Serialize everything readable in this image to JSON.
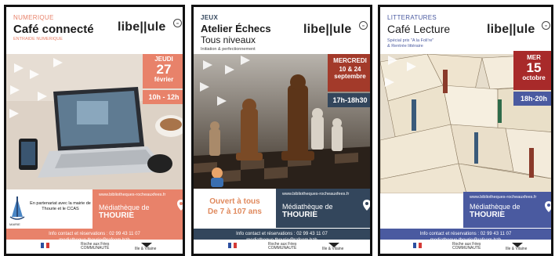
{
  "posters": [
    {
      "category": "NUMERIQUE",
      "title": "Café connecté",
      "subtitle_lines": [
        "ENTRAIDE NUMERIQUE"
      ],
      "logo": "libe||ule",
      "date": {
        "day_name": "JEUDI",
        "day": "27",
        "month": "février"
      },
      "time": "10h - 12h",
      "partner_text": "En partenariat avec la mairie de Thourie et le CCAS",
      "partner_logo_label": "MAIRIE",
      "url": "www.bibliotheques-rocheauxfees.fr",
      "venue_line1": "Médiathèque de",
      "venue_line2": "THOURIE",
      "contact_line1": "Info contact et réservations : 02 99 43 11 07",
      "contact_line2": "mediatheque.thourie@rafcom.bzh",
      "footer": {
        "cc_line1": "Roche aux Fées",
        "cc_line2": "COMMUNAUTÉ",
        "dept": "Ille & Vilaine"
      },
      "colors": {
        "accent": "#e8826a",
        "contact_bg": "#e8826a"
      }
    },
    {
      "category": "JEUX",
      "title": "Atelier Échecs",
      "title2": "Tous niveaux",
      "subtitle_lines": [
        "Initiation & perfectionnement"
      ],
      "logo": "libe||ule",
      "date": {
        "day_name": "MERCREDI",
        "day": "10 & 24",
        "month": "septembre"
      },
      "time": "17h-18h30",
      "open_line1": "Ouvert à tous",
      "open_line2": "De 7 à 107 ans",
      "url": "www.bibliotheques-rocheauxfees.fr",
      "venue_line1": "Médiathèque de",
      "venue_line2": "THOURIE",
      "contact_line1": "Info contact et réservations : 02 99 43 11 07",
      "contact_line2": "mediatheque.thourie@rafcom.bzh",
      "footer": {
        "cc_line1": "Roche aux Fées",
        "cc_line2": "COMMUNAUTÉ",
        "dept": "Ille & Vilaine"
      },
      "colors": {
        "accent": "#33465c",
        "datebox": "#a33a2a",
        "timebox": "#33465c",
        "contact_bg": "#33465c"
      }
    },
    {
      "category": "LITTERATURES",
      "title": "Café Lecture",
      "subtitle_lines": [
        "Spécial prix \"A la Foli're\"",
        "& Rentrée littéraire"
      ],
      "logo": "libe||ule",
      "date": {
        "day_name": "MER",
        "day": "15",
        "month": "octobre"
      },
      "time": "18h-20h",
      "url": "www.bibliotheques-rocheauxfees.fr",
      "venue_line1": "Médiathèque de",
      "venue_line2": "THOURIE",
      "contact_line1": "Info contact et réservations : 02 99 43 11 07",
      "contact_line2": "mediatheque.thourie@rafcom.bzh",
      "footer": {
        "cc_line1": "Roche aux Fées",
        "cc_line2": "COMMUNAUTÉ",
        "dept": "Ille & Vilaine"
      },
      "colors": {
        "accent": "#4a5aa0",
        "datebox": "#a82a2a",
        "timebox": "#4a5aa0",
        "contact_bg": "#4a5aa0"
      }
    }
  ]
}
